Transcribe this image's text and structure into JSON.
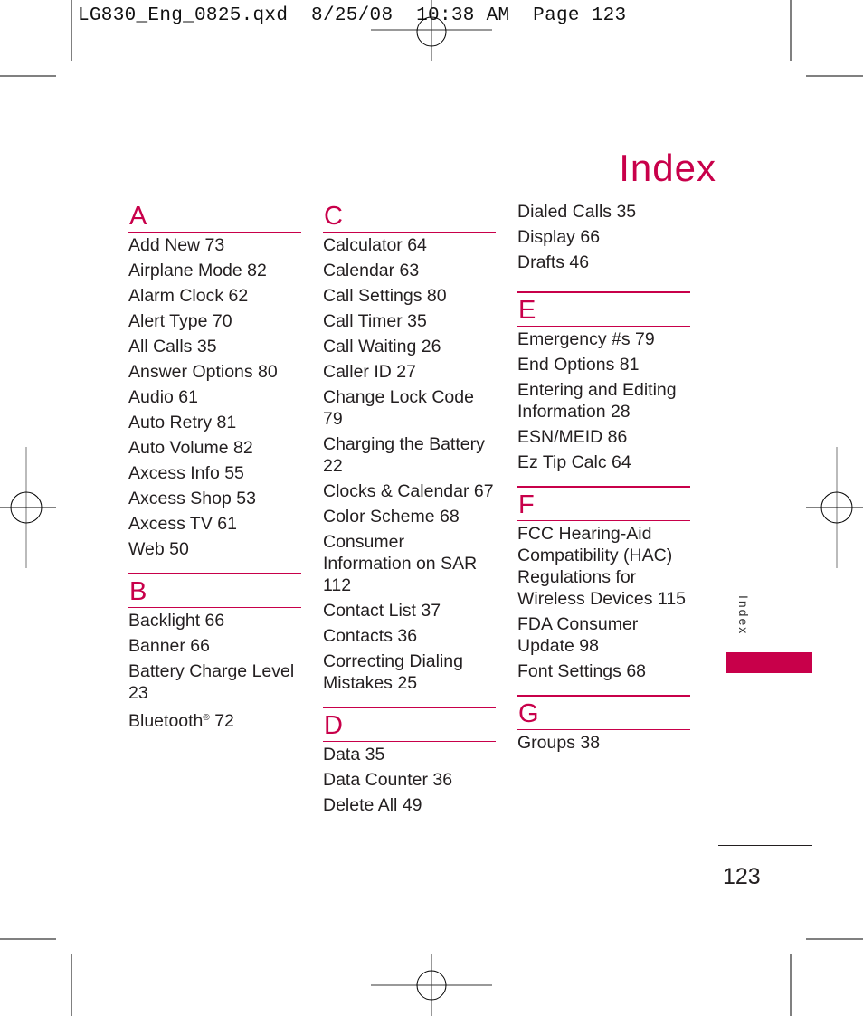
{
  "slug_line": "LG830_Eng_0825.qxd  8/25/08  10:38 AM  Page 123",
  "title": "Index",
  "side_tab_label": "Index",
  "page_number": "123",
  "accent_color": "#c8004a",
  "columns": [
    {
      "sections": [
        {
          "letter": "A",
          "entries": [
            "Add New 73",
            "Airplane Mode 82",
            "Alarm Clock 62",
            "Alert Type 70",
            "All Calls 35",
            "Answer Options 80",
            "Audio 61",
            "Auto Retry 81",
            "Auto Volume 82",
            "Axcess Info 55",
            "Axcess Shop 53",
            "Axcess TV 61",
            "Web 50"
          ]
        },
        {
          "letter": "B",
          "entries": [
            "Backlight 66",
            "Banner 66",
            "Battery Charge Level 23",
            "Bluetooth",
            "Charging the Battery 22"
          ]
        }
      ]
    },
    {
      "sections": [
        {
          "letter": "C",
          "entries": [
            "Calculator 64",
            "Calendar 63",
            "Call Settings 80",
            "Call Timer 35",
            "Call Waiting 26",
            "Caller ID 27",
            "Change Lock Code 79",
            "Charging the Battery 22",
            "Clocks & Calendar 67",
            "Color Scheme 68",
            "Consumer Information on SAR 112",
            "Contact List 37",
            "Contacts 36",
            "Correcting Dialing Mistakes 25"
          ]
        },
        {
          "letter": "D",
          "entries": [
            "Data 35",
            "Data Counter 36",
            "Delete All 49"
          ]
        }
      ]
    },
    {
      "sections": [
        {
          "letter": "",
          "entries": [
            "Dialed Calls 35",
            "Display 66",
            "Drafts 46"
          ]
        },
        {
          "letter": "E",
          "entries": [
            "Emergency #s 79",
            "End Options 81",
            "Entering and Editing Information 28",
            "ESN/MEID 86",
            "Ez Tip Calc 64"
          ]
        },
        {
          "letter": "F",
          "entries": [
            "FCC Hearing-Aid Compatibility (HAC) Regulations for Wireless Devices 115",
            "FDA Consumer Update 98",
            "Font Settings 68"
          ]
        },
        {
          "letter": "G",
          "entries": [
            "Groups 38"
          ]
        }
      ]
    }
  ],
  "bluetooth_entry": {
    "text": "Bluetooth",
    "mark": "®",
    "page": " 72"
  }
}
